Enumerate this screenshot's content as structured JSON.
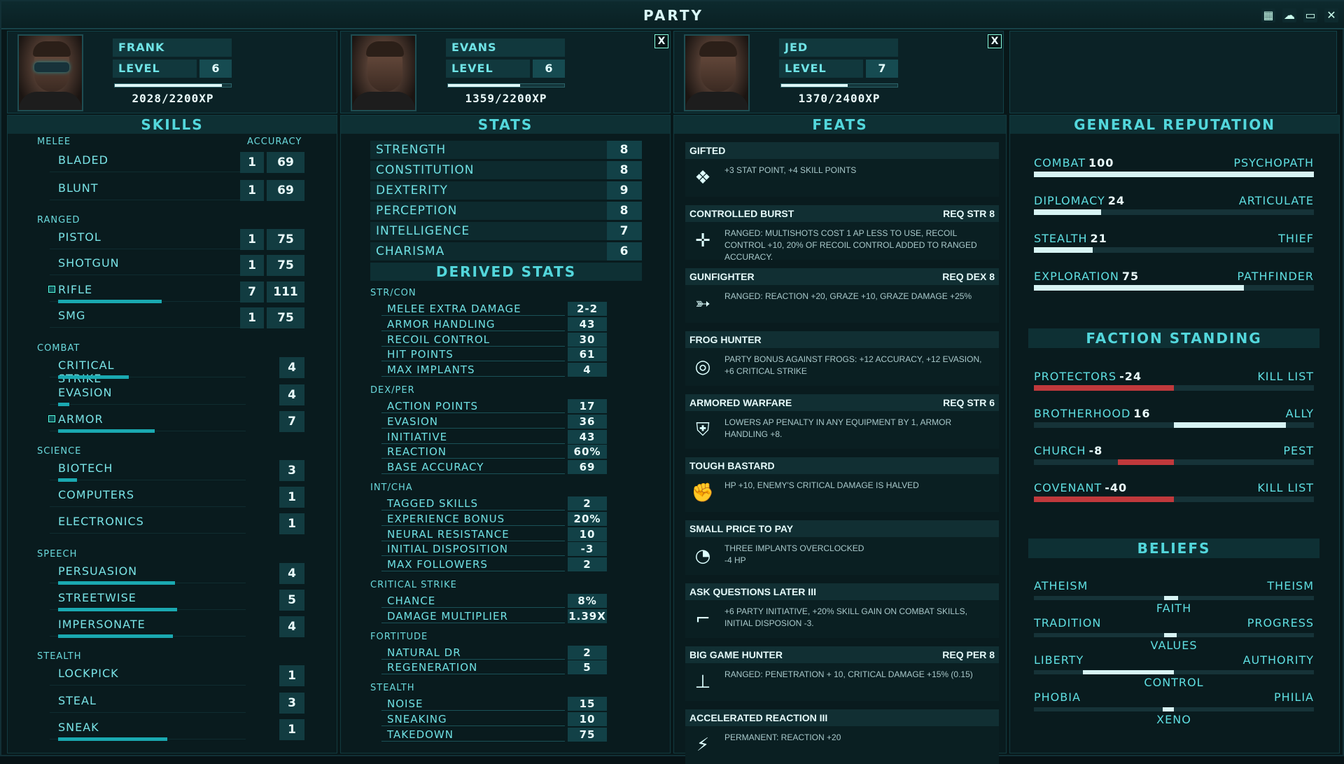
{
  "title": "PARTY",
  "colors": {
    "accent": "#53d7dc",
    "bar": "#1aa9b1",
    "negative": "#c0393c",
    "positive": "#d8f4f4"
  },
  "window_icons": [
    "calendar-icon",
    "brain-icon",
    "chat-icon",
    "close-icon"
  ],
  "party": [
    {
      "name": "FRANK",
      "level_label": "LEVEL",
      "level": "6",
      "xp": "2028/2200XP",
      "xp_fraction": 0.92,
      "closable": false
    },
    {
      "name": "EVANS",
      "level_label": "LEVEL",
      "level": "6",
      "xp": "1359/2200XP",
      "xp_fraction": 0.62,
      "closable": true
    },
    {
      "name": "JED",
      "level_label": "LEVEL",
      "level": "7",
      "xp": "1370/2400XP",
      "xp_fraction": 0.57,
      "closable": true
    }
  ],
  "close_label": "X",
  "skills": {
    "heading": "SKILLS",
    "melee": "MELEE",
    "accuracy": "ACCURACY",
    "ranged": "RANGED",
    "combat": "COMBAT",
    "science": "SCIENCE",
    "speech": "SPEECH",
    "stealth": "STEALTH",
    "items": [
      {
        "name": "BLADED",
        "val": "1",
        "acc": "69",
        "bar": 0
      },
      {
        "name": "BLUNT",
        "val": "1",
        "acc": "69",
        "bar": 0
      },
      {
        "name": "PISTOL",
        "val": "1",
        "acc": "75",
        "bar": 0
      },
      {
        "name": "SHOTGUN",
        "val": "1",
        "acc": "75",
        "bar": 0
      },
      {
        "name": "RIFLE",
        "val": "7",
        "acc": "111",
        "bar": 0.56,
        "tagged": true
      },
      {
        "name": "SMG",
        "val": "1",
        "acc": "75",
        "bar": 0
      },
      {
        "name": "CRITICAL STRIKE",
        "val": "4",
        "bar": 0.38
      },
      {
        "name": "EVASION",
        "val": "4",
        "bar": 0.06
      },
      {
        "name": "ARMOR",
        "val": "7",
        "bar": 0.52,
        "tagged": true
      },
      {
        "name": "BIOTECH",
        "val": "3",
        "bar": 0.1
      },
      {
        "name": "COMPUTERS",
        "val": "1",
        "bar": 0
      },
      {
        "name": "ELECTRONICS",
        "val": "1",
        "bar": 0
      },
      {
        "name": "PERSUASION",
        "val": "4",
        "bar": 0.63
      },
      {
        "name": "STREETWISE",
        "val": "5",
        "bar": 0.64
      },
      {
        "name": "IMPERSONATE",
        "val": "4",
        "bar": 0.62
      },
      {
        "name": "LOCKPICK",
        "val": "1",
        "bar": 0
      },
      {
        "name": "STEAL",
        "val": "3",
        "bar": 0
      },
      {
        "name": "SNEAK",
        "val": "1",
        "bar": 0.59
      }
    ]
  },
  "stats": {
    "heading": "STATS",
    "items": [
      {
        "name": "STRENGTH",
        "val": "8"
      },
      {
        "name": "CONSTITUTION",
        "val": "8"
      },
      {
        "name": "DEXTERITY",
        "val": "9"
      },
      {
        "name": "PERCEPTION",
        "val": "8"
      },
      {
        "name": "INTELLIGENCE",
        "val": "7"
      },
      {
        "name": "CHARISMA",
        "val": "6"
      }
    ],
    "derived_heading": "DERIVED STATS",
    "groups": [
      {
        "name": "STR/CON",
        "items": [
          {
            "n": "MELEE EXTRA DAMAGE",
            "v": "2-2"
          },
          {
            "n": "ARMOR HANDLING",
            "v": "43"
          },
          {
            "n": "RECOIL CONTROL",
            "v": "30"
          },
          {
            "n": "HIT POINTS",
            "v": "61"
          },
          {
            "n": "MAX IMPLANTS",
            "v": "4"
          }
        ]
      },
      {
        "name": "DEX/PER",
        "items": [
          {
            "n": "ACTION POINTS",
            "v": "17"
          },
          {
            "n": "EVASION",
            "v": "36"
          },
          {
            "n": "INITIATIVE",
            "v": "43"
          },
          {
            "n": "REACTION",
            "v": "60%"
          },
          {
            "n": "BASE ACCURACY",
            "v": "69"
          }
        ]
      },
      {
        "name": "INT/CHA",
        "items": [
          {
            "n": "TAGGED SKILLS",
            "v": "2"
          },
          {
            "n": "EXPERIENCE BONUS",
            "v": "20%"
          },
          {
            "n": "NEURAL RESISTANCE",
            "v": "10"
          },
          {
            "n": "INITIAL DISPOSITION",
            "v": "-3"
          },
          {
            "n": "MAX FOLLOWERS",
            "v": "2"
          }
        ]
      },
      {
        "name": "CRITICAL STRIKE",
        "items": [
          {
            "n": "CHANCE",
            "v": "8%"
          },
          {
            "n": "DAMAGE MULTIPLIER",
            "v": "1.39x"
          }
        ]
      },
      {
        "name": "FORTITUDE",
        "items": [
          {
            "n": "NATURAL DR",
            "v": "2"
          },
          {
            "n": "REGENERATION",
            "v": "5"
          }
        ]
      },
      {
        "name": "STEALTH",
        "items": [
          {
            "n": "NOISE",
            "v": "15"
          },
          {
            "n": "SNEAKING",
            "v": "10"
          },
          {
            "n": "TAKEDOWN",
            "v": "75"
          }
        ]
      }
    ]
  },
  "feats": {
    "heading": "FEATS",
    "items": [
      {
        "name": "GIFTED",
        "req": "",
        "desc": "+3 STAT POINT, +4 SKILL POINTS",
        "icon": "gift-icon",
        "glyph": "❖"
      },
      {
        "name": "CONTROLLED BURST",
        "req": "REQ STR 8",
        "desc": "RANGED: MULTISHOTS COST 1 AP LESS TO USE, RECOIL CONTROL +10, 20% OF RECOIL CONTROL ADDED TO RANGED ACCURACY.",
        "icon": "crosshair-icon",
        "glyph": "✛"
      },
      {
        "name": "GUNFIGHTER",
        "req": "REQ DEX 8",
        "desc": "RANGED: REACTION +20, GRAZE +10, GRAZE DAMAGE +25%",
        "icon": "gun-icon",
        "glyph": "➳"
      },
      {
        "name": "FROG HUNTER",
        "req": "",
        "desc": "PARTY BONUS AGAINST FROGS: +12 ACCURACY, +12 EVASION, +6 CRITICAL STRIKE",
        "icon": "frog-target-icon",
        "glyph": "◎"
      },
      {
        "name": "ARMORED WARFARE",
        "req": "REQ STR 6",
        "desc": "LOWERS AP PENALTY IN ANY EQUIPMENT BY 1, ARMOR HANDLING +8.",
        "icon": "armor-icon",
        "glyph": "⛨"
      },
      {
        "name": "TOUGH BASTARD",
        "req": "",
        "desc": "HP +10, ENEMY'S CRITICAL DAMAGE IS HALVED",
        "icon": "fist-icon",
        "glyph": "✊"
      },
      {
        "name": "SMALL PRICE TO PAY",
        "req": "",
        "desc": "THREE IMPLANTS OVERCLOCKED\n-4 HP",
        "icon": "gauge-icon",
        "glyph": "◔"
      },
      {
        "name": "ASK QUESTIONS LATER III",
        "req": "",
        "desc": "+6 PARTY INITIATIVE, +20% SKILL GAIN ON COMBAT SKILLS, INITIAL DISPOSION -3.",
        "icon": "smg-icon",
        "glyph": "⌐"
      },
      {
        "name": "BIG GAME HUNTER",
        "req": "REQ PER 8",
        "desc": "RANGED: PENETRATION + 10, CRITICAL DAMAGE +15% (0.15)",
        "icon": "rifle-icon",
        "glyph": "⊥"
      },
      {
        "name": "ACCELERATED REACTION III",
        "req": "",
        "desc": "PERMANENT: REACTION +20",
        "icon": "reaction-icon",
        "glyph": "⚡"
      }
    ]
  },
  "reputation": {
    "heading": "GENERAL REPUTATION",
    "items": [
      {
        "name": "COMBAT",
        "val": "100",
        "title": "PSYCHOPATH",
        "fill": 1.0
      },
      {
        "name": "DIPLOMACY",
        "val": "24",
        "title": "ARTICULATE",
        "fill": 0.24
      },
      {
        "name": "STEALTH",
        "val": "21",
        "title": "THIEF",
        "fill": 0.21
      },
      {
        "name": "EXPLORATION",
        "val": "75",
        "title": "PATHFINDER",
        "fill": 0.75
      }
    ]
  },
  "factions": {
    "heading": "FACTION STANDING",
    "items": [
      {
        "name": "PROTECTORS",
        "val": "-24",
        "title": "KILL LIST",
        "fill": -0.5
      },
      {
        "name": "BROTHERHOOD",
        "val": "16",
        "title": "ALLY",
        "fill": 0.4
      },
      {
        "name": "CHURCH",
        "val": "-8",
        "title": "PEST",
        "fill": -0.2
      },
      {
        "name": "COVENANT",
        "val": "-40",
        "title": "KILL LIST",
        "fill": -0.5
      }
    ]
  },
  "beliefs": {
    "heading": "BELIEFS",
    "items": [
      {
        "left": "ATHEISM",
        "right": "THEISM",
        "center": "FAITH",
        "value": 0.03
      },
      {
        "left": "TRADITION",
        "right": "PROGRESS",
        "center": "VALUES",
        "value": 0.02
      },
      {
        "left": "LIBERTY",
        "right": "AUTHORITY",
        "center": "CONTROL",
        "value": -0.65
      },
      {
        "left": "PHOBIA",
        "right": "PHILIA",
        "center": "XENO",
        "value": -0.08
      }
    ]
  }
}
